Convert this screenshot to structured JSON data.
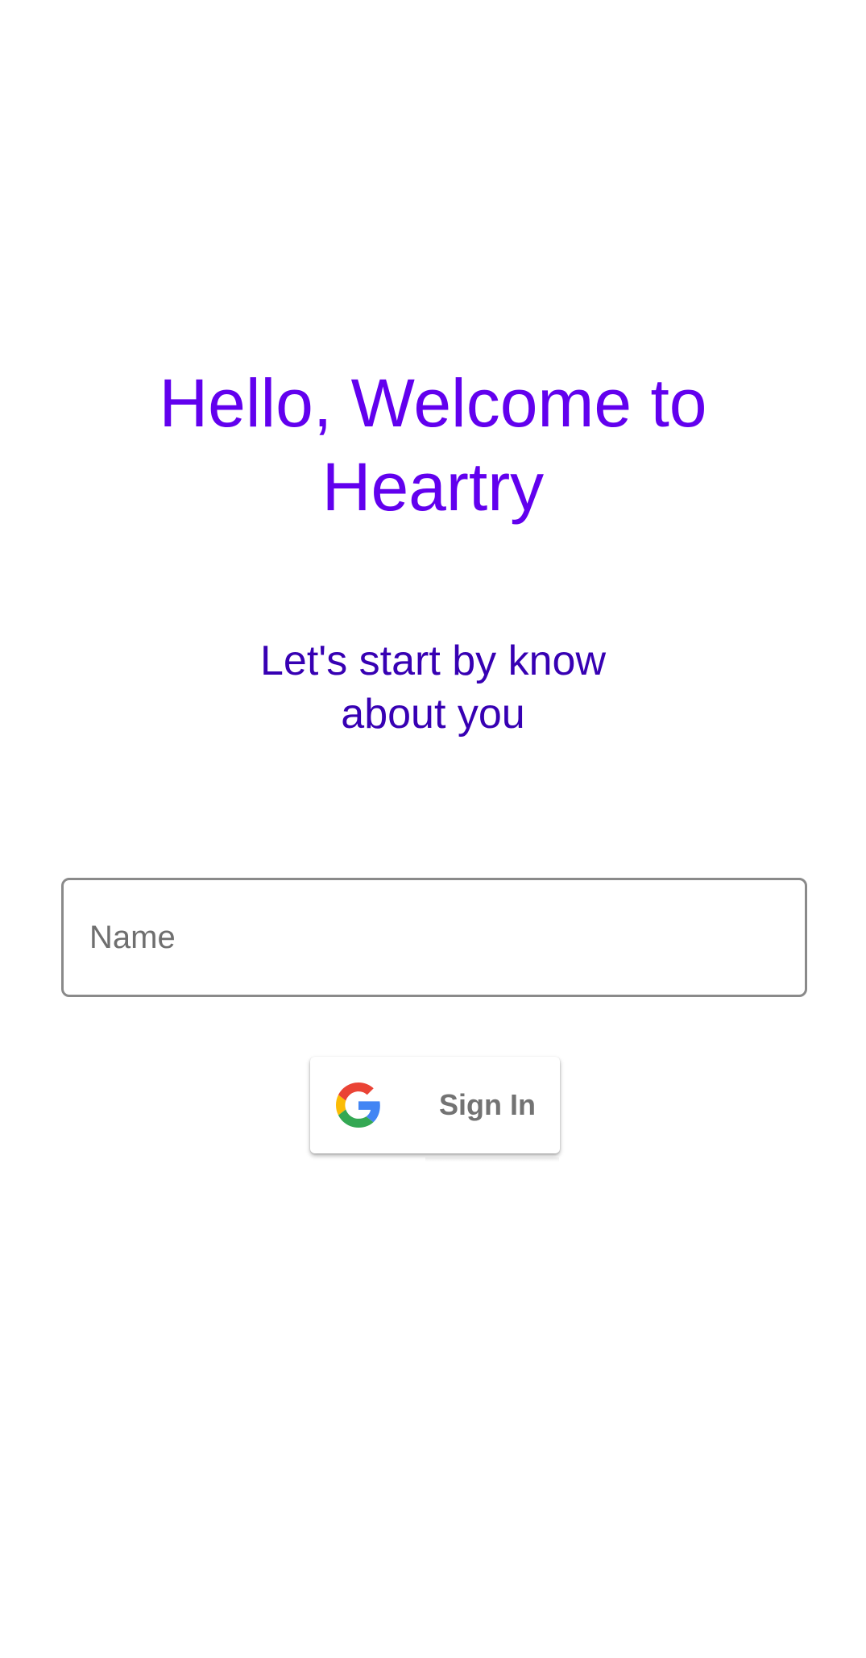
{
  "header": {
    "title_lines": [
      "Hello, Welcome to",
      "Heartry"
    ],
    "subtitle_lines": [
      "Let's start by know",
      "about you"
    ]
  },
  "form": {
    "name_field": {
      "placeholder": "Name",
      "value": ""
    }
  },
  "signin": {
    "label": "Sign In",
    "icon": "google-logo-icon"
  },
  "colors": {
    "title": "#6200ee",
    "subtitle": "#3700b3",
    "field_border": "#8a8a8a",
    "button_text": "#737373",
    "google_blue": "#4285F4",
    "google_red": "#EA4335",
    "google_yellow": "#FBBC05",
    "google_green": "#34A853"
  }
}
